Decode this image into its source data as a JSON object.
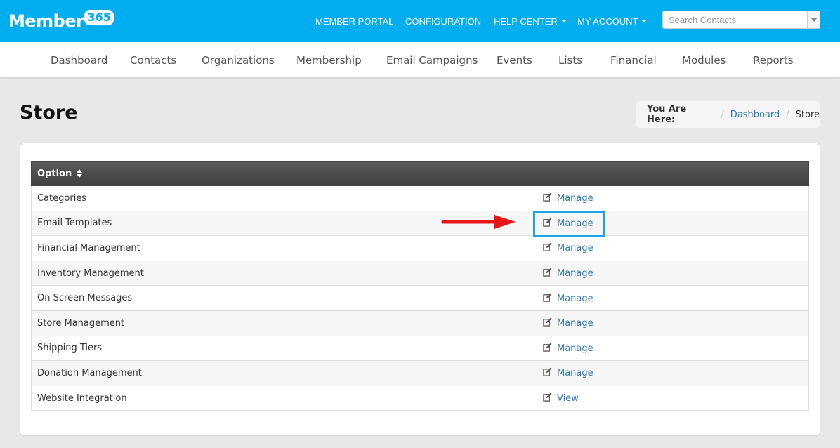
{
  "brand": {
    "name": "Member",
    "badge": "365"
  },
  "topnav": {
    "member_portal": "MEMBER PORTAL",
    "configuration": "CONFIGURATION",
    "help_center": "HELP CENTER",
    "my_account": "MY ACCOUNT"
  },
  "search": {
    "placeholder": "Search Contacts"
  },
  "subnav": [
    "Dashboard",
    "Contacts",
    "Organizations",
    "Membership",
    "Email Campaigns",
    "Events",
    "Lists",
    "Financial",
    "Modules",
    "Reports"
  ],
  "page": {
    "title": "Store"
  },
  "breadcrumb": {
    "label": "You Are Here:",
    "home": "Dashboard",
    "current": "Store"
  },
  "table": {
    "header": {
      "option": "Option",
      "action": ""
    },
    "rows": [
      {
        "option": "Categories",
        "action": "Manage"
      },
      {
        "option": "Email Templates",
        "action": "Manage"
      },
      {
        "option": "Financial Management",
        "action": "Manage"
      },
      {
        "option": "Inventory Management",
        "action": "Manage"
      },
      {
        "option": "On Screen Messages",
        "action": "Manage"
      },
      {
        "option": "Store Management",
        "action": "Manage"
      },
      {
        "option": "Shipping Tiers",
        "action": "Manage"
      },
      {
        "option": "Donation Management",
        "action": "Manage"
      },
      {
        "option": "Website Integration",
        "action": "View"
      }
    ]
  },
  "colors": {
    "brand": "#00aeef",
    "link": "#337ab7",
    "highlight": "#1ea3e8",
    "arrow": "#e8151b"
  },
  "icons": {
    "row_action": "edit-icon"
  }
}
